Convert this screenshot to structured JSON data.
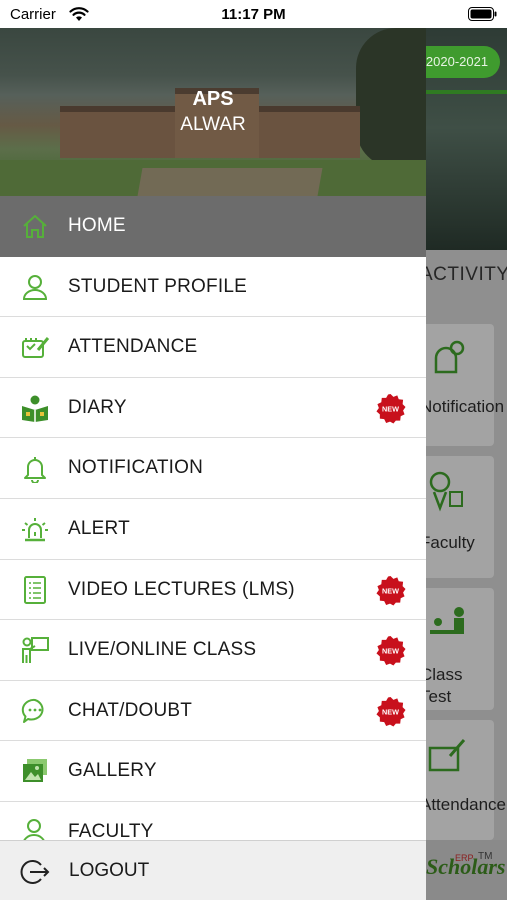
{
  "status_bar": {
    "carrier": "Carrier",
    "time": "11:17 PM"
  },
  "background": {
    "session": "2020-2021",
    "activity_heading": "ACTIVITY",
    "cards": [
      "Notification",
      "Faculty",
      "Class Test",
      "Attendance"
    ],
    "brand": "Scholars",
    "erp": "ERP",
    "trademark": "TM"
  },
  "drawer": {
    "school_name": "APS",
    "school_city": "ALWAR",
    "items": [
      {
        "label": "HOME",
        "icon": "home-icon",
        "is_new": false
      },
      {
        "label": "STUDENT PROFILE",
        "icon": "user-icon",
        "is_new": false
      },
      {
        "label": "ATTENDANCE",
        "icon": "attendance-icon",
        "is_new": false
      },
      {
        "label": "DIARY",
        "icon": "diary-icon",
        "is_new": true
      },
      {
        "label": "NOTIFICATION",
        "icon": "bell-icon",
        "is_new": false
      },
      {
        "label": "ALERT",
        "icon": "alarm-icon",
        "is_new": false
      },
      {
        "label": "VIDEO LECTURES (LMS)",
        "icon": "document-icon",
        "is_new": true
      },
      {
        "label": "LIVE/ONLINE CLASS",
        "icon": "teacher-board-icon",
        "is_new": true
      },
      {
        "label": "CHAT/DOUBT",
        "icon": "chat-icon",
        "is_new": true
      },
      {
        "label": "GALLERY",
        "icon": "gallery-icon",
        "is_new": false
      },
      {
        "label": "FACULTY",
        "icon": "faculty-icon",
        "is_new": false
      }
    ],
    "new_badge": "NEW",
    "logout_label": "LOGOUT"
  },
  "colors": {
    "accent_green": "#3f9b2e",
    "icon_green": "#56b03a",
    "badge_red": "#c8101c",
    "active_row": "#6c6c6c"
  }
}
